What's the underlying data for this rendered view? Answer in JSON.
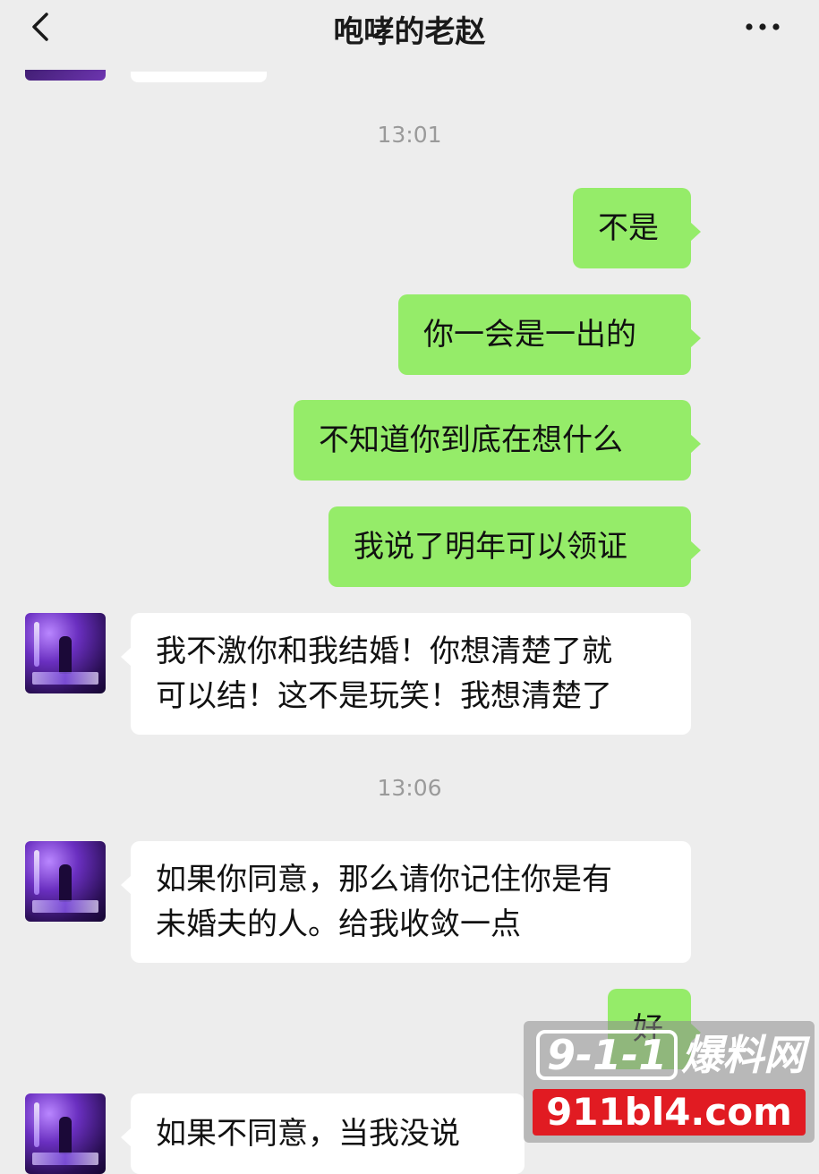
{
  "header": {
    "title": "咆哮的老赵",
    "back_icon": "chevron-left-icon",
    "more_icon": "more-dots-icon"
  },
  "timestamps": [
    "13:01",
    "13:06"
  ],
  "messages": [
    {
      "side": "right",
      "lines": [
        "不是"
      ]
    },
    {
      "side": "right",
      "lines": [
        "你一会是一出的"
      ]
    },
    {
      "side": "right",
      "lines": [
        "不知道你到底在想什么"
      ]
    },
    {
      "side": "right",
      "lines": [
        "我说了明年可以领证"
      ]
    },
    {
      "side": "left",
      "lines": [
        "我不激你和我结婚！你想清楚了就",
        "可以结！这不是玩笑！我想清楚了"
      ]
    },
    {
      "side": "left",
      "lines": [
        "如果你同意，那么请你记住你是有",
        "未婚夫的人。给我收敛一点"
      ]
    },
    {
      "side": "right",
      "lines": [
        "好"
      ]
    },
    {
      "side": "left",
      "lines": [
        "如果不同意，当我没说"
      ]
    }
  ],
  "watermark": {
    "logo_box": "9-1-1",
    "logo_text": "爆料网",
    "url": "911bl4.com"
  },
  "colors": {
    "background": "#ededed",
    "sent_bubble": "#95ec69",
    "received_bubble": "#ffffff",
    "timestamp": "#9a9a9a",
    "watermark_url_bg": "#e11b22"
  }
}
